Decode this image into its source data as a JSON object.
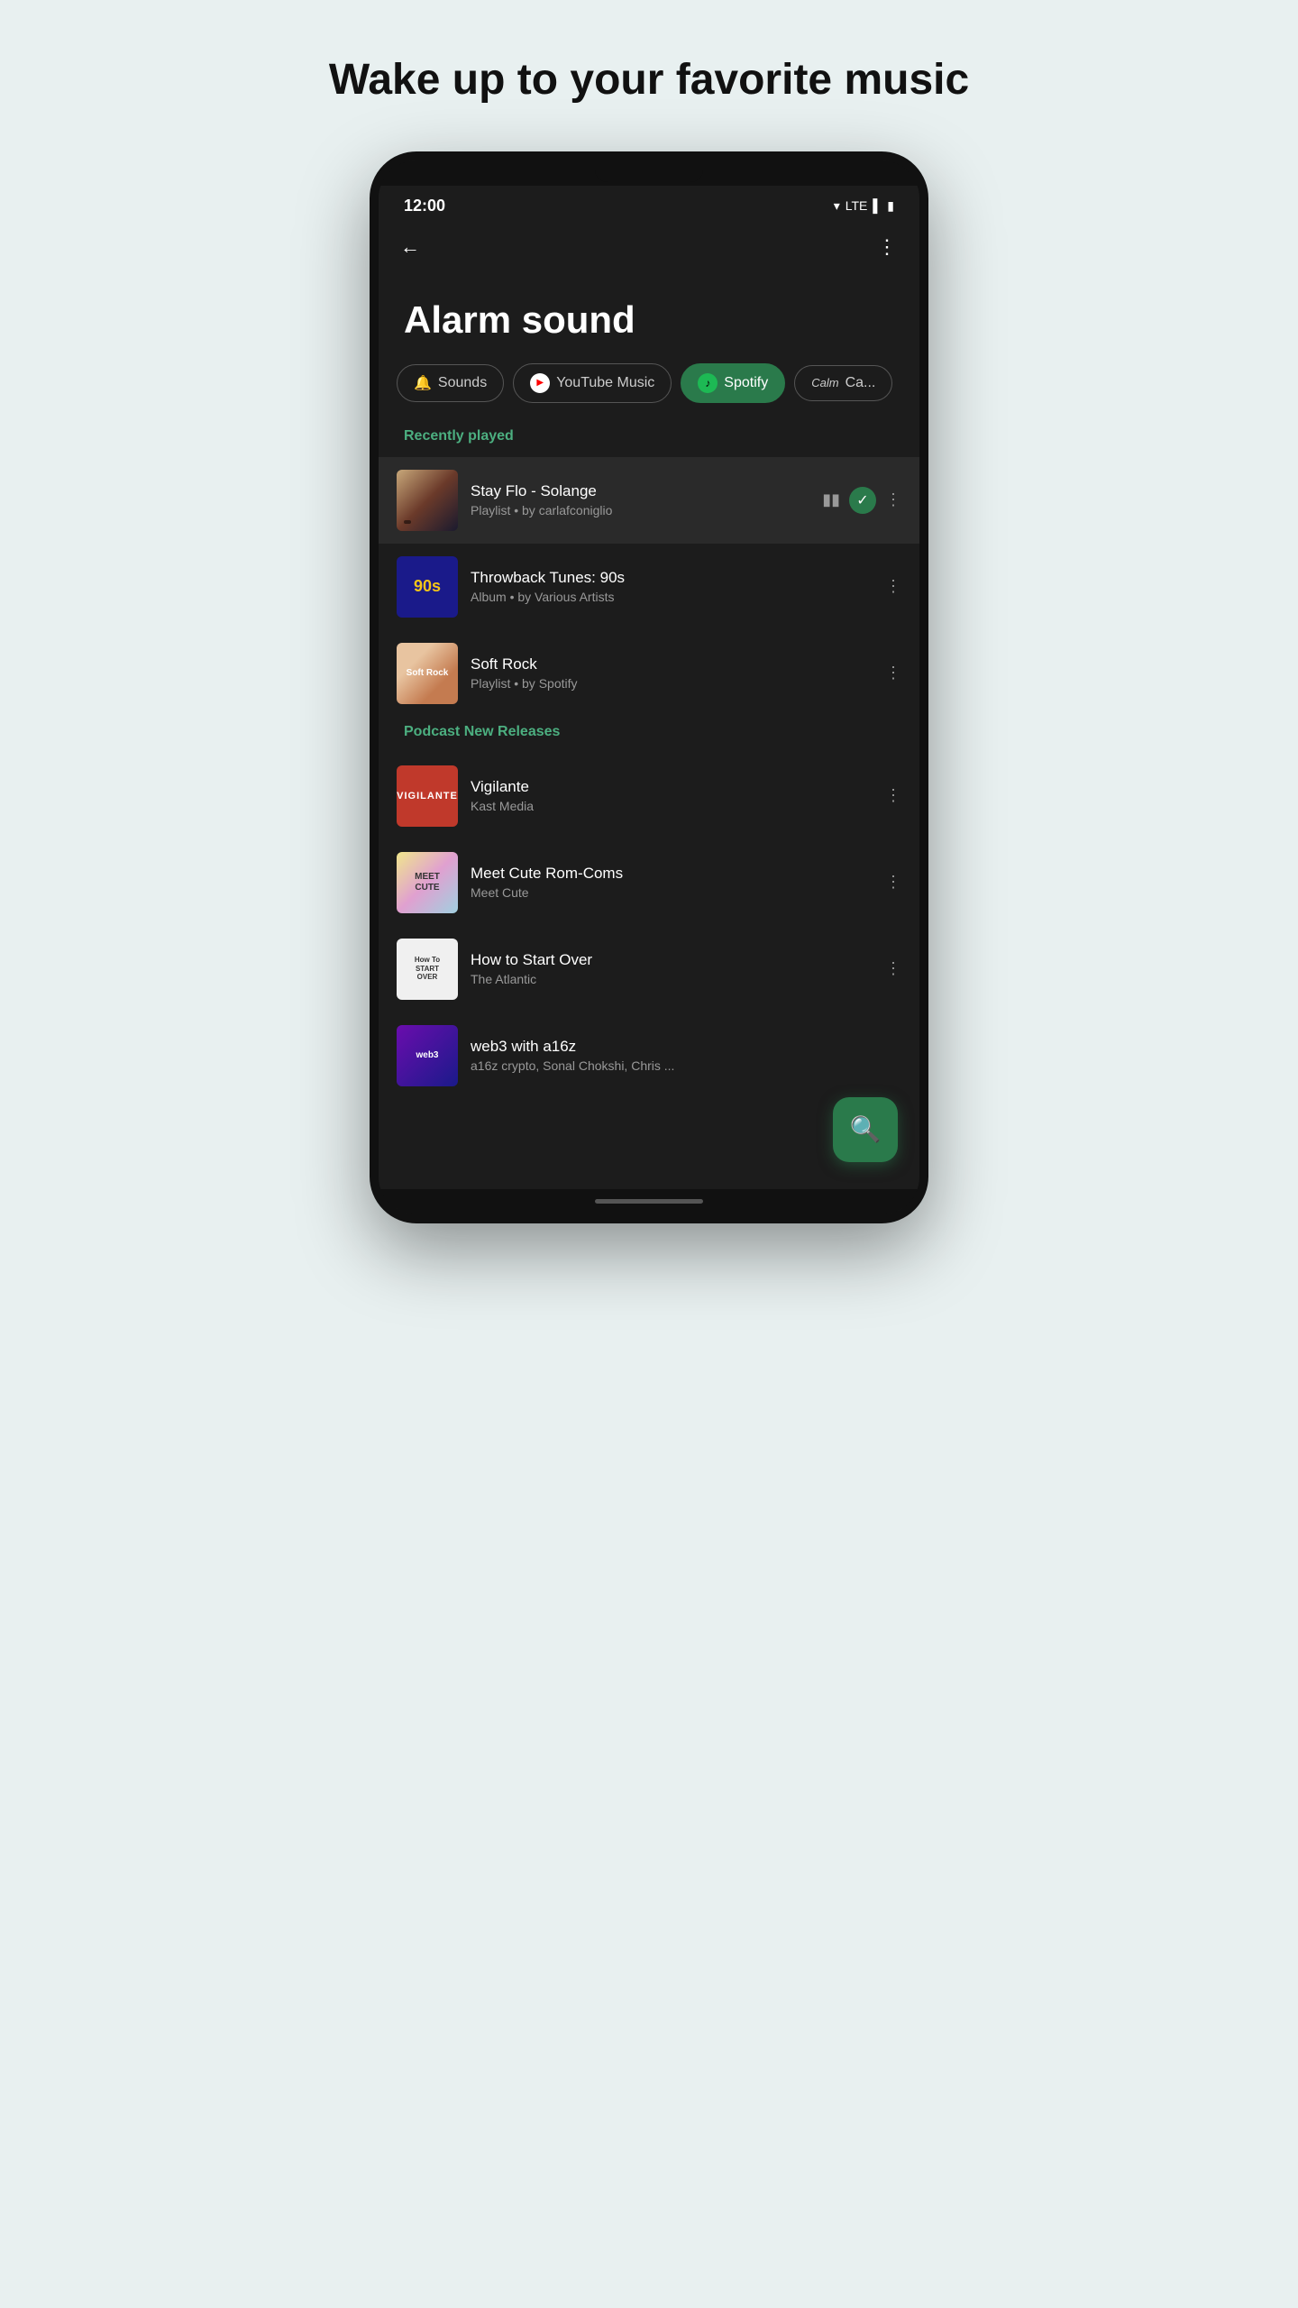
{
  "page": {
    "headline": "Wake up to your favorite music"
  },
  "status_bar": {
    "time": "12:00",
    "network": "LTE"
  },
  "app_bar": {
    "back_label": "←",
    "more_label": "⋮"
  },
  "screen": {
    "title": "Alarm sound"
  },
  "tabs": [
    {
      "id": "sounds",
      "label": "Sounds",
      "icon": "🔔",
      "active": false
    },
    {
      "id": "youtube",
      "label": "YouTube Music",
      "icon": "▶",
      "active": false
    },
    {
      "id": "spotify",
      "label": "Spotify",
      "icon": "♪",
      "active": true
    },
    {
      "id": "calm",
      "label": "Ca...",
      "icon": "",
      "active": false
    }
  ],
  "recently_played": {
    "heading": "Recently played",
    "items": [
      {
        "id": "stay-flo",
        "title": "Stay Flo - Solange",
        "subtitle": "Playlist • by carlafconiglio",
        "art_label": "",
        "art_class": "art-stay-flo",
        "selected": true,
        "has_bars": true,
        "has_check": true
      },
      {
        "id": "throwback",
        "title": "Throwback Tunes: 90s",
        "subtitle": "Album • by Various Artists",
        "art_label": "90s",
        "art_class": "art-throwback",
        "selected": false,
        "has_bars": false,
        "has_check": false
      },
      {
        "id": "soft-rock",
        "title": "Soft Rock",
        "subtitle": "Playlist • by Spotify",
        "art_label": "Soft Rock",
        "art_class": "art-soft-rock",
        "selected": false,
        "has_bars": false,
        "has_check": false
      }
    ]
  },
  "podcast_releases": {
    "heading": "Podcast New Releases",
    "items": [
      {
        "id": "vigilante",
        "title": "Vigilante",
        "subtitle": "Kast Media",
        "art_label": "VIGILANTE",
        "art_class": "art-vigilante"
      },
      {
        "id": "meet-cute",
        "title": "Meet Cute Rom-Coms",
        "subtitle": "Meet Cute",
        "art_label": "MEET CUTE",
        "art_class": "art-meet-cute"
      },
      {
        "id": "start-over",
        "title": "How to Start Over",
        "subtitle": "The Atlantic",
        "art_label": "How To START OVER",
        "art_class": "art-start-over"
      },
      {
        "id": "web3",
        "title": "web3 with a16z",
        "subtitle": "a16z crypto, Sonal Chokshi, Chris ...",
        "art_label": "web3",
        "art_class": "art-web3"
      }
    ]
  },
  "fab": {
    "icon": "🔍"
  },
  "icons": {
    "more": "⋮",
    "bars": "▮▮▮",
    "check": "✓",
    "search": "🔍"
  }
}
